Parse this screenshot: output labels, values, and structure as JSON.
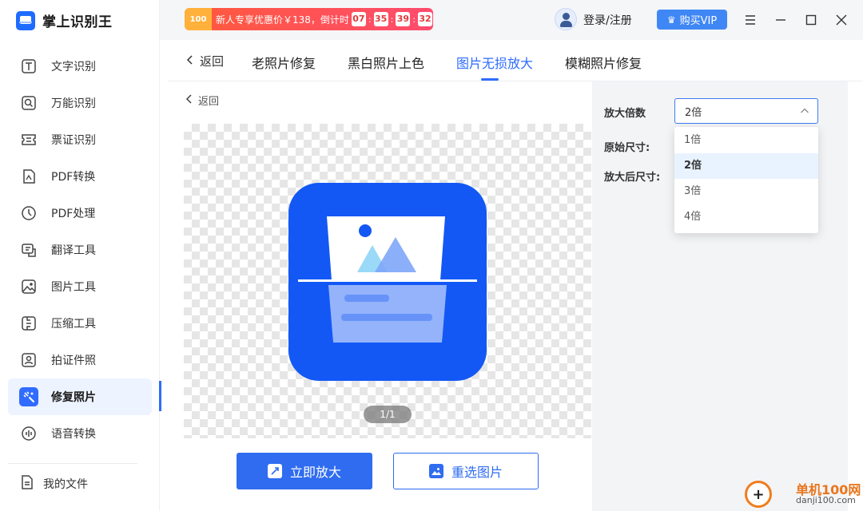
{
  "app": {
    "title": "掌上识别王"
  },
  "sidebar": {
    "items": [
      {
        "label": "文字识别",
        "icon": "text-recognition-icon"
      },
      {
        "label": "万能识别",
        "icon": "universal-scan-icon"
      },
      {
        "label": "票证识别",
        "icon": "ticket-scan-icon"
      },
      {
        "label": "PDF转换",
        "icon": "pdf-convert-icon"
      },
      {
        "label": "PDF处理",
        "icon": "pdf-process-icon"
      },
      {
        "label": "翻译工具",
        "icon": "translate-icon"
      },
      {
        "label": "图片工具",
        "icon": "image-tools-icon"
      },
      {
        "label": "压缩工具",
        "icon": "compress-icon"
      },
      {
        "label": "拍证件照",
        "icon": "id-photo-icon"
      },
      {
        "label": "修复照片",
        "icon": "repair-photo-icon",
        "active": true
      },
      {
        "label": "语音转换",
        "icon": "voice-convert-icon"
      }
    ],
    "my_files": "我的文件"
  },
  "topbar": {
    "promo_badge": "100",
    "promo_text": "新人专享优惠价￥138，倒计时",
    "countdown": [
      "07",
      "35",
      "39",
      "32"
    ],
    "login": "登录/注册",
    "vip": "购买VIP"
  },
  "tabs": {
    "back": "返回",
    "items": [
      "老照片修复",
      "黑白照片上色",
      "图片无损放大",
      "模糊照片修复"
    ],
    "active_index": 2
  },
  "content": {
    "back": "返回",
    "pager": "1/1",
    "primary_button": "立即放大",
    "secondary_button": "重选图片"
  },
  "panel": {
    "scale_label": "放大倍数",
    "original_size_label": "原始尺寸:",
    "scaled_size_label": "放大后尺寸:",
    "selected": "2倍",
    "options": [
      "1倍",
      "2倍",
      "3倍",
      "4倍"
    ]
  },
  "watermark": {
    "text1": "单机100网",
    "text2": "danji100.com"
  },
  "colors": {
    "accent": "#2f6cff",
    "promo": "#ff5a3c",
    "vip": "#3f87f5",
    "watermark": "#e9751c"
  }
}
